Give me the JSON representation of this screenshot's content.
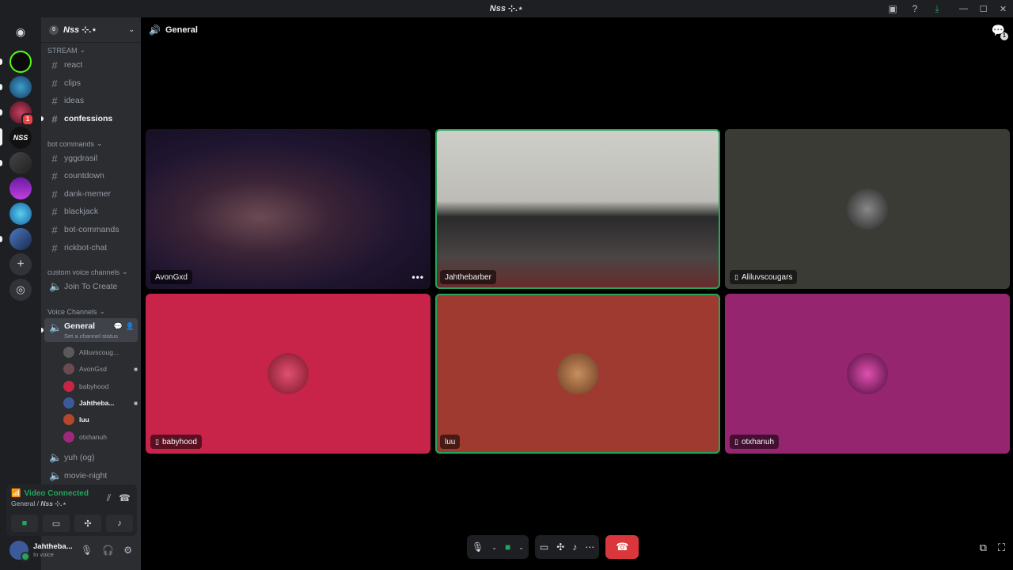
{
  "window": {
    "title": "Nss ⊹.⋆"
  },
  "server": {
    "name": "Nss ⊹.⋆",
    "icon_letter": "0"
  },
  "guild_rail": [
    {
      "id": "discord-home",
      "badge": ""
    },
    {
      "id": "kick",
      "badge": ""
    },
    {
      "id": "vibe-out",
      "badge": ""
    },
    {
      "id": "astro",
      "badge": "1"
    },
    {
      "id": "nss",
      "badge": ""
    },
    {
      "id": "server-5",
      "badge": ""
    },
    {
      "id": "server-6",
      "badge": ""
    },
    {
      "id": "server-7",
      "badge": ""
    },
    {
      "id": "server-8",
      "badge": ""
    }
  ],
  "categories": {
    "stream": "STREAM",
    "bot_commands": "bot commands",
    "custom_voice": "custom voice channels",
    "voice": "Voice Channels"
  },
  "stream_channels": [
    "react",
    "clips",
    "ideas",
    "confessions"
  ],
  "bot_channels": [
    "yggdrasil",
    "countdown",
    "dank-memer",
    "blackjack",
    "bot-commands",
    "rickbot-chat"
  ],
  "custom_voice_channels": [
    "Join To Create"
  ],
  "voice_general": {
    "name": "General",
    "status": "Set a channel status"
  },
  "voice_users": [
    {
      "name": "Aliluvscoug...",
      "color": "#5a5a5a",
      "cam": false,
      "bold": false
    },
    {
      "name": "AvonGxd",
      "color": "#6b4a52",
      "cam": true,
      "bold": false
    },
    {
      "name": "babyhood",
      "color": "#c62644",
      "cam": false,
      "bold": false
    },
    {
      "name": "Jahtheba...",
      "color": "#3c5a99",
      "cam": true,
      "bold": true
    },
    {
      "name": "luu",
      "color": "#b3462c",
      "cam": false,
      "bold": true
    },
    {
      "name": "otxhanuh",
      "color": "#a0287a",
      "cam": false,
      "bold": false
    }
  ],
  "other_voice_channels": [
    "yuh (og)",
    "movie-night"
  ],
  "rtc": {
    "status": "Video Connected",
    "channel": "General / ",
    "server": "Nss ⊹.⋆"
  },
  "user": {
    "name": "Jahtheba...",
    "status": "In voice"
  },
  "stage": {
    "channel": "General"
  },
  "tiles": [
    {
      "name": "AvonGxd",
      "phone": false,
      "speaking": false
    },
    {
      "name": "Jahthebarber",
      "phone": false,
      "speaking": true
    },
    {
      "name": "Aliluvscougars",
      "phone": true,
      "speaking": false,
      "bg": "#3b3b36"
    },
    {
      "name": "babyhood",
      "phone": true,
      "speaking": false,
      "bg": "#c8244a"
    },
    {
      "name": "luu",
      "phone": false,
      "speaking": true,
      "bg": "#9e3a30"
    },
    {
      "name": "otxhanuh",
      "phone": true,
      "speaking": false,
      "bg": "#962570"
    }
  ],
  "icons": {
    "chat": "chat-bubble-icon",
    "mic": "microphone-icon",
    "camera": "camera-icon",
    "screen": "screen-share-icon",
    "activity": "activity-icon",
    "soundboard": "soundboard-icon",
    "more": "more-icon",
    "hangup": "hangup-icon"
  }
}
